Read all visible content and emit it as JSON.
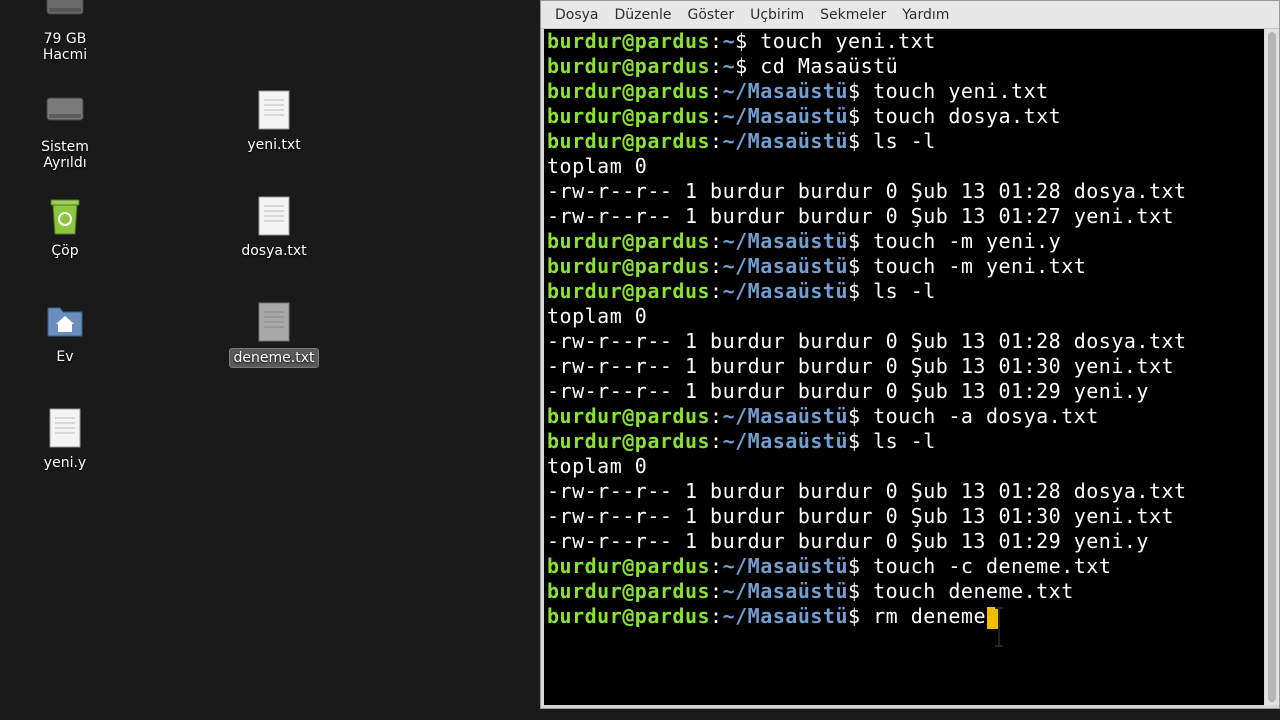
{
  "desktop": {
    "icons": [
      {
        "label": "79 GB\nHacmi",
        "icon": "drive-icon"
      },
      {
        "label": "Sistem\nAyrıldı",
        "icon": "drive-icon"
      },
      {
        "label": "Çöp",
        "icon": "trash-icon"
      },
      {
        "label": "Ev",
        "icon": "home-folder-icon"
      },
      {
        "label": "yeni.y",
        "icon": "text-file-icon"
      },
      {
        "label": "yeni.txt",
        "icon": "text-file-icon"
      },
      {
        "label": "dosya.txt",
        "icon": "text-file-icon"
      },
      {
        "label": "deneme.txt",
        "icon": "text-file-icon",
        "selected": true
      }
    ]
  },
  "terminal": {
    "menu": [
      "Dosya",
      "Düzenle",
      "Göster",
      "Uçbirim",
      "Sekmeler",
      "Yardım"
    ],
    "prompt": {
      "user": "burdur@pardus",
      "home": "~",
      "dir": "~/Masaüstü"
    },
    "lines": [
      {
        "type": "prompt",
        "path": "~",
        "cmd": "touch yeni.txt"
      },
      {
        "type": "prompt",
        "path": "~",
        "cmd": "cd Masaüstü"
      },
      {
        "type": "prompt",
        "path": "~/Masaüstü",
        "cmd": "touch yeni.txt"
      },
      {
        "type": "prompt",
        "path": "~/Masaüstü",
        "cmd": "touch dosya.txt"
      },
      {
        "type": "prompt",
        "path": "~/Masaüstü",
        "cmd": "ls -l"
      },
      {
        "type": "out",
        "text": "toplam 0"
      },
      {
        "type": "out",
        "text": "-rw-r--r-- 1 burdur burdur 0 Şub 13 01:28 dosya.txt"
      },
      {
        "type": "out",
        "text": "-rw-r--r-- 1 burdur burdur 0 Şub 13 01:27 yeni.txt"
      },
      {
        "type": "prompt",
        "path": "~/Masaüstü",
        "cmd": "touch -m yeni.y"
      },
      {
        "type": "prompt",
        "path": "~/Masaüstü",
        "cmd": "touch -m yeni.txt"
      },
      {
        "type": "prompt",
        "path": "~/Masaüstü",
        "cmd": "ls -l"
      },
      {
        "type": "out",
        "text": "toplam 0"
      },
      {
        "type": "out",
        "text": "-rw-r--r-- 1 burdur burdur 0 Şub 13 01:28 dosya.txt"
      },
      {
        "type": "out",
        "text": "-rw-r--r-- 1 burdur burdur 0 Şub 13 01:30 yeni.txt"
      },
      {
        "type": "out",
        "text": "-rw-r--r-- 1 burdur burdur 0 Şub 13 01:29 yeni.y"
      },
      {
        "type": "prompt",
        "path": "~/Masaüstü",
        "cmd": "touch -a dosya.txt"
      },
      {
        "type": "prompt",
        "path": "~/Masaüstü",
        "cmd": "ls -l"
      },
      {
        "type": "out",
        "text": "toplam 0"
      },
      {
        "type": "out",
        "text": "-rw-r--r-- 1 burdur burdur 0 Şub 13 01:28 dosya.txt"
      },
      {
        "type": "out",
        "text": "-rw-r--r-- 1 burdur burdur 0 Şub 13 01:30 yeni.txt"
      },
      {
        "type": "out",
        "text": "-rw-r--r-- 1 burdur burdur 0 Şub 13 01:29 yeni.y"
      },
      {
        "type": "prompt",
        "path": "~/Masaüstü",
        "cmd": "touch -c deneme.txt"
      },
      {
        "type": "prompt",
        "path": "~/Masaüstü",
        "cmd": "touch deneme.txt"
      },
      {
        "type": "prompt",
        "path": "~/Masaüstü",
        "cmd": "rm deneme",
        "cursor": true
      }
    ]
  },
  "colors": {
    "prompt_user": "#8ae234",
    "prompt_path": "#729fcf",
    "cursor": "#f0c000"
  }
}
